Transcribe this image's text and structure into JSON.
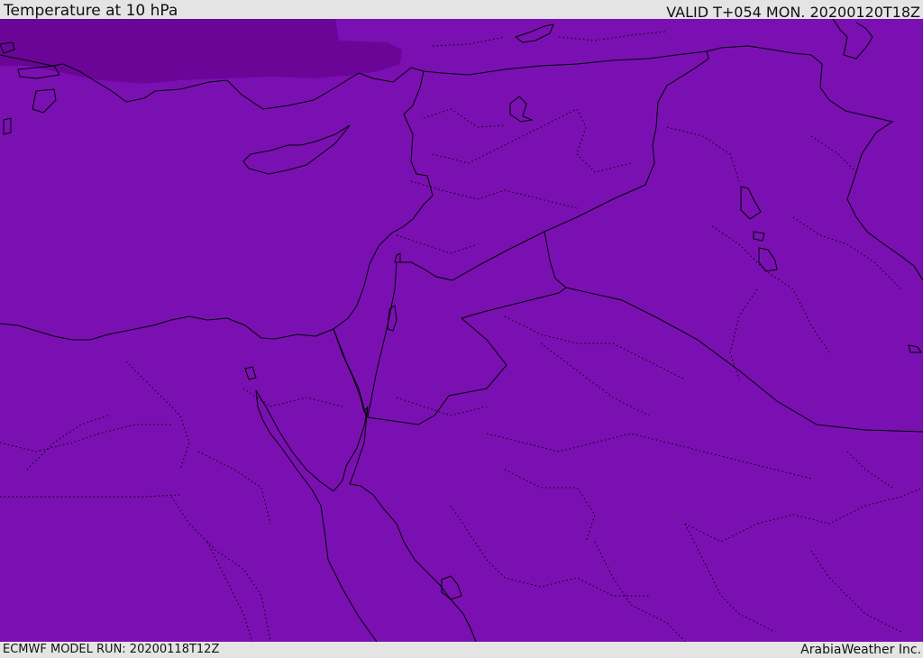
{
  "header": {
    "title": "Temperature at 10 hPa",
    "valid_time": "VALID T+054 MON. 20200120T18Z"
  },
  "footer": {
    "model_run": "ECMWF MODEL RUN: 20200118T12Z",
    "credit": "ArabiaWeather Inc."
  },
  "map": {
    "field_color": "#7a10b2",
    "cold_pocket_color": "#6a0598",
    "coastline_color": "#000000"
  }
}
